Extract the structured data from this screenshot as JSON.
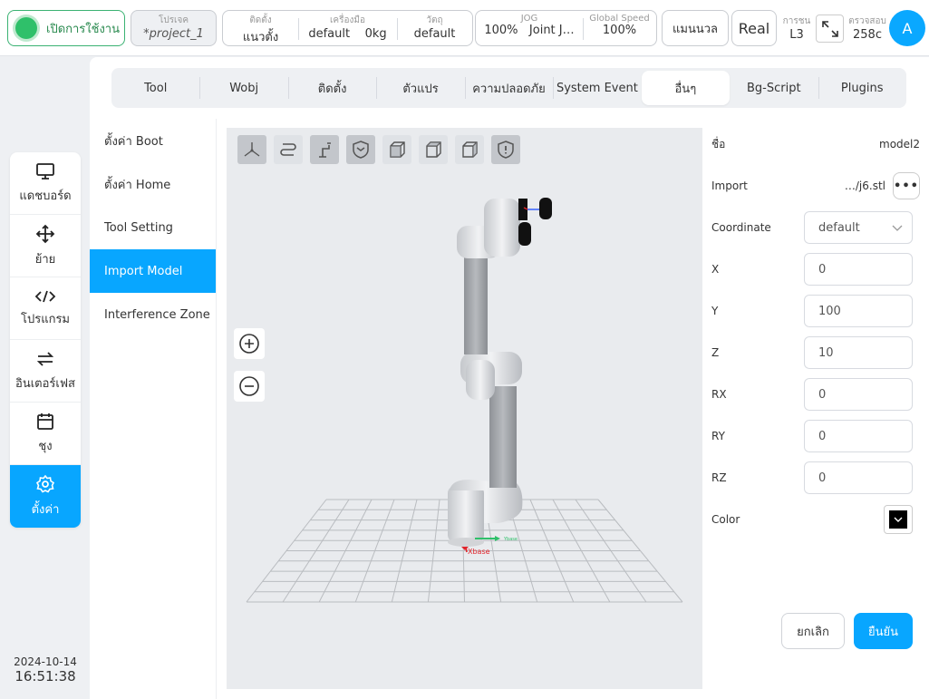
{
  "topbar": {
    "power_label": "เปิดการใช้งาน",
    "project": {
      "label": "โปรเจค",
      "value": "*project_1"
    },
    "install_group": [
      {
        "label": "ติดตั้ง",
        "value": "แนวตั้ง"
      },
      {
        "label": "เครื่องมือ",
        "value": "default    0kg"
      },
      {
        "label": "วัตถุ",
        "value": "default"
      }
    ],
    "jog_group": [
      {
        "label": "JOG",
        "value": "100%   Joint J…"
      },
      {
        "label": "Global Speed",
        "value": "100%"
      }
    ],
    "mode_button": "แมนนวล",
    "real_button": "Real",
    "level": {
      "label": "การชน",
      "value": "L3"
    },
    "check": {
      "label": "ตรวจสอบ",
      "value": "258c"
    },
    "avatar": "A"
  },
  "leftnav": [
    {
      "label": "แดชบอร์ด",
      "icon": "monitor-icon"
    },
    {
      "label": "ย้าย",
      "icon": "move-icon"
    },
    {
      "label": "โปรแกรม",
      "icon": "code-icon"
    },
    {
      "label": "อินเตอร์เฟส",
      "icon": "interface-icon"
    },
    {
      "label": "ชุง",
      "icon": "calendar-icon"
    },
    {
      "label": "ตั้งค่า",
      "icon": "gear-icon",
      "active": true
    }
  ],
  "datetime": {
    "date": "2024-10-14",
    "time": "16:51:38"
  },
  "tabs": [
    "Tool",
    "Wobj",
    "ติดตั้ง",
    "ตัวแปร",
    "ความปลอดภัย",
    "System Event",
    "อื่นๆ",
    "Bg-Script",
    "Plugins"
  ],
  "active_tab": "อื่นๆ",
  "submenu": [
    "ตั้งค่า Boot",
    "ตั้งค่า Home",
    "Tool Setting",
    "Import Model",
    "Interference Zone"
  ],
  "active_submenu": "Import Model",
  "viewer": {
    "axis_label_x": "Xbase",
    "axis_label_y": "Ybase"
  },
  "props": {
    "name_label": "ชื่อ",
    "name_value": "model2",
    "import_label": "Import",
    "import_value": "…/j6.stl",
    "import_button": "•••",
    "coordinate_label": "Coordinate",
    "coordinate_value": "default",
    "x_label": "X",
    "x_value": "0",
    "y_label": "Y",
    "y_value": "100",
    "z_label": "Z",
    "z_value": "10",
    "rx_label": "RX",
    "rx_value": "0",
    "ry_label": "RY",
    "ry_value": "0",
    "rz_label": "RZ",
    "rz_value": "0",
    "color_label": "Color",
    "color_value": "#000000",
    "cancel_button": "ยกเลิก",
    "confirm_button": "ยืนยัน"
  },
  "colors": {
    "accent": "#08a6ff",
    "power_on": "#2fc06a"
  }
}
